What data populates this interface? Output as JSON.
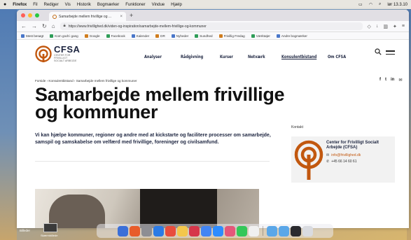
{
  "menubar": {
    "app": "Firefox",
    "items": [
      "Fil",
      "Rediger",
      "Vis",
      "Historik",
      "Bogmærker",
      "Funktioner",
      "Vindue",
      "Hjælp"
    ],
    "clock": "lør 13.3.10"
  },
  "browser": {
    "tab_title": "Samarbejde mellem frivillige og ...",
    "url": "https://www.frivillighed.dk/viden-og-inspiration/samarbejde-mellem-frivillige-og-kommuner",
    "bookmarks": [
      "Mest besøgt",
      "Kom godt i gang",
      "Google",
      "Facebook",
      "Kalender",
      "DR",
      "Nyheder",
      "Sundhed",
      "Frivillig Fredag",
      "Værktøjer",
      "Andre bogmærker"
    ]
  },
  "site": {
    "logo_name": "CFSA",
    "logo_subtitle": "Center for Frivilligt Socialt Arbejde",
    "nav": [
      "Analyser",
      "Rådgivning",
      "Kurser",
      "Netværk",
      "Konsulentbistand",
      "Om CFSA"
    ],
    "breadcrumb": "Forside  ›  Konsulentbistand  ›  Samarbejde mellem frivillige og kommuner",
    "social": [
      "f",
      "t",
      "in",
      "✉"
    ],
    "title": "Samarbejde mellem frivillige og kommuner",
    "lead": "Vi kan hjælpe kommuner, regioner og andre med at kickstarte og facilitere processer om samarbejde, samspil og samskabelse om velfærd med frivillige, foreninger og civilsamfund.",
    "contact_label": "Kontakt",
    "contact_org": "Center for Frivilligt Socialt Arbejde (CFSA)",
    "contact_email": "info@frivillighed.dk",
    "contact_phone": "+45 66 14 60 61"
  },
  "desktop": {
    "thumbnail_label": "Skærmbillede",
    "left_label": "Billeder"
  },
  "colors": {
    "brand_orange": "#c2580f",
    "brand_navy": "#1d2540"
  }
}
